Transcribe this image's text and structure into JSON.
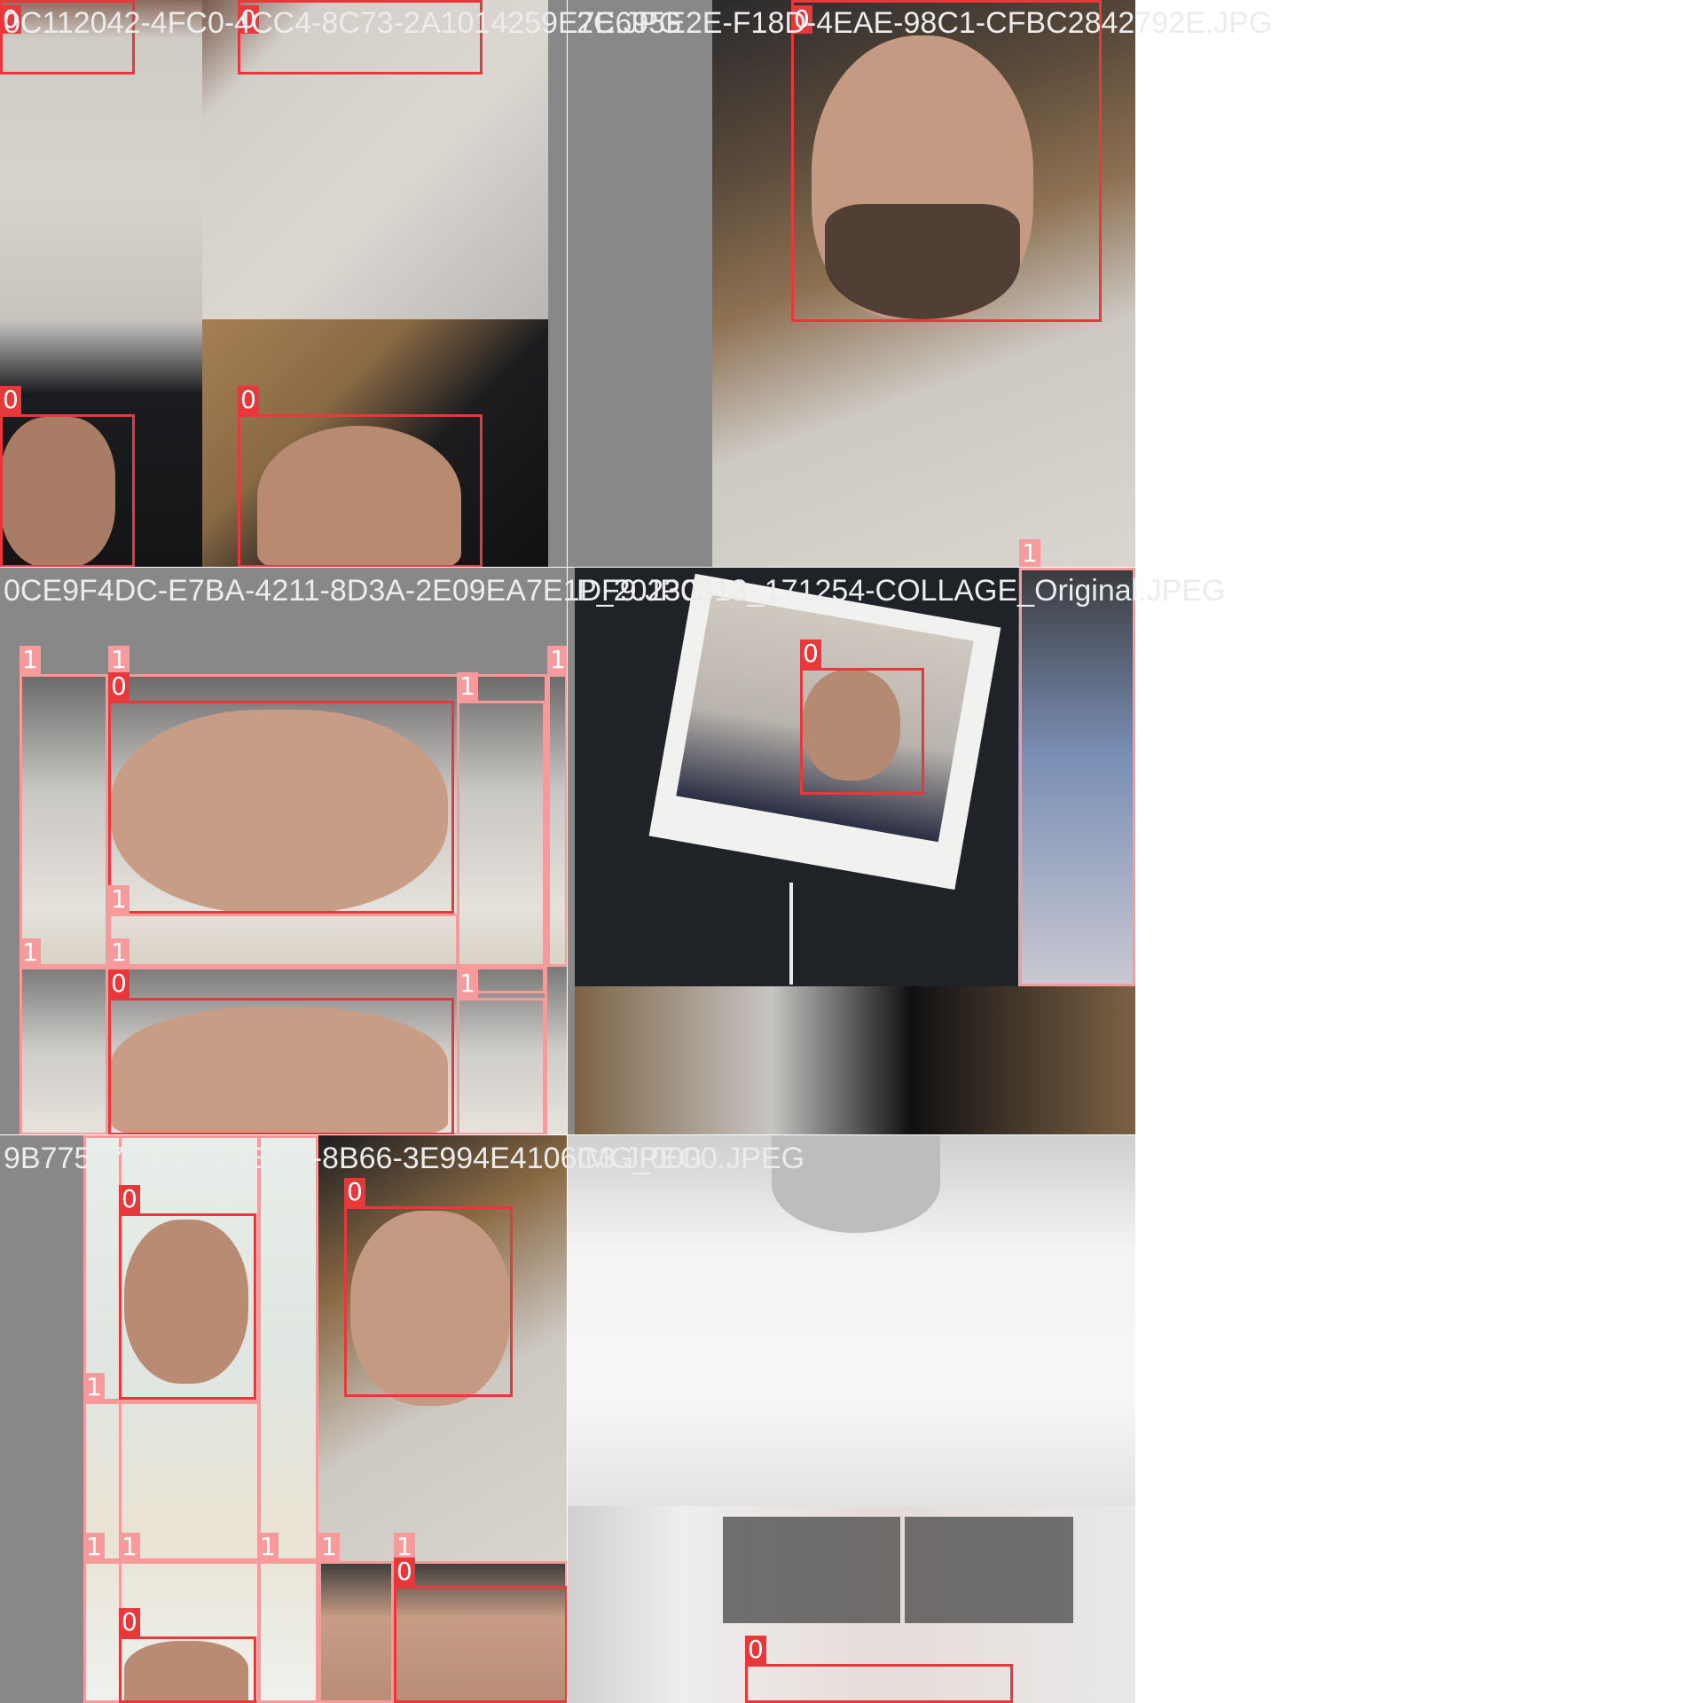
{
  "colors": {
    "class_0": "#e8383b",
    "class_1": "#f79a9b",
    "padding": "#888888",
    "filename_text": "#ececec"
  },
  "tiles": [
    {
      "filename": "0C112042-4FC0-4CC4-8C73-2A1014259E7E.JPG"
    },
    {
      "filename": "2C695E2E-F18D-4EAE-98C1-CFBC2842792E.JPG"
    },
    {
      "filename": "0CE9F4DC-E7BA-4211-8D3A-2E09EA7E1DF9.JPG"
    },
    {
      "filename": "P_20230313_171254-COLLAGE_Original.JPEG"
    },
    {
      "filename": "9B775777-C7F8-4BCF-8B66-3E994E4106C3.JPEG"
    },
    {
      "filename": "IMG_0000.JPEG"
    }
  ],
  "box_labels": {
    "class_0": "0",
    "class_1": "1"
  }
}
